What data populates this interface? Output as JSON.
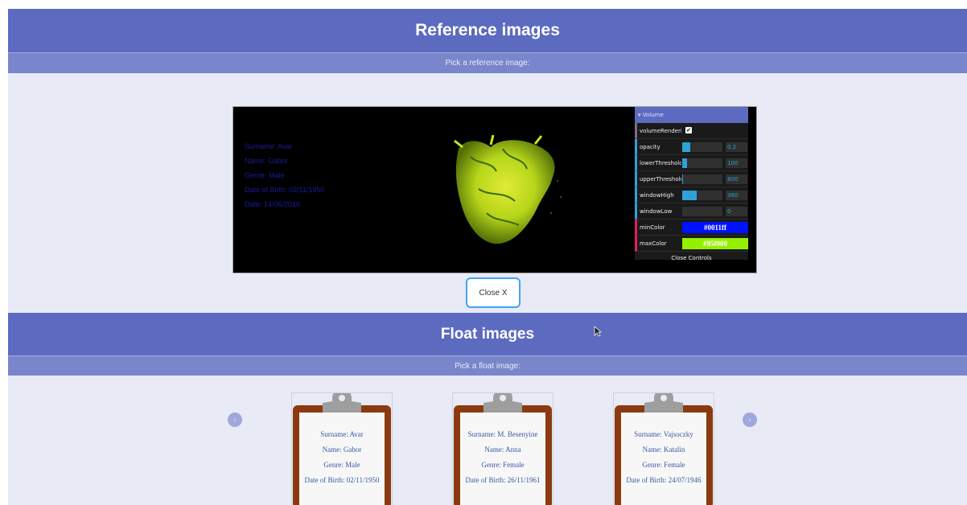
{
  "reference": {
    "title": "Reference images",
    "subtitle": "Pick a reference image:",
    "info": {
      "surname": "Surname: Avar",
      "name": "Name: Gabor",
      "genre": "Genre: Male",
      "dob": "Date of Birth: 02/11/1950",
      "date": "Date: 14/06/2016"
    },
    "gui": {
      "folder_label": "▾ Volume",
      "rows": [
        {
          "label": "volumeRenderi..."
        },
        {
          "label": "opacity",
          "value": "0.2",
          "level": 0.2
        },
        {
          "label": "lowerThreshold",
          "value": "100",
          "level": 0.12
        },
        {
          "label": "upperThreshold",
          "value": "800",
          "level": 0.02
        },
        {
          "label": "windowHigh",
          "value": "360",
          "level": 0.36
        },
        {
          "label": "windowLow",
          "value": "0",
          "level": 0.0
        },
        {
          "label": "minColor",
          "value": "#0011ff"
        },
        {
          "label": "maxColor",
          "value": "#95f000"
        }
      ],
      "close_controls": "Close Controls"
    },
    "close_button": "Close X"
  },
  "float": {
    "title": "Float images",
    "subtitle": "Pick a float image:",
    "prev_arrow": "‹",
    "next_arrow": "›",
    "cards": [
      {
        "surname": "Surname: Avar",
        "name": "Name: Gabor",
        "genre": "Genre: Male",
        "dob": "Date of Birth: 02/11/1950"
      },
      {
        "surname": "Surname: M. Besenyine",
        "name": "Name: Anna",
        "genre": "Genre: Female",
        "dob": "Date of Birth: 26/11/1961"
      },
      {
        "surname": "Surname: Vajsoczky",
        "name": "Name: Katalin",
        "genre": "Genre: Female",
        "dob": "Date of Birth: 24/07/1946"
      }
    ]
  },
  "colors": {
    "header": "#5c6bc0",
    "subheader": "#7986cb",
    "background": "#e8eaf6",
    "min_color": "#0011ff",
    "max_color": "#95f000",
    "accent": "#2fa1d6",
    "clipboard": "#8b3a0f"
  }
}
